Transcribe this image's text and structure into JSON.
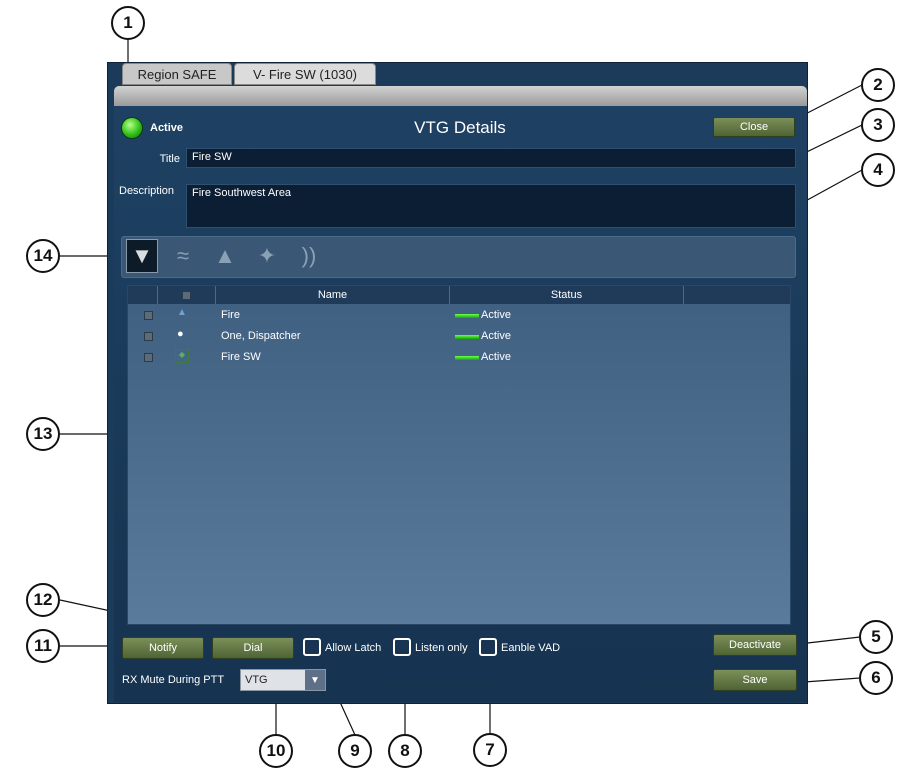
{
  "tabs": [
    {
      "label": "Region SAFE"
    },
    {
      "label": "V- Fire SW (1030)"
    }
  ],
  "header": {
    "status_label": "Active",
    "title": "VTG Details",
    "close_label": "Close"
  },
  "form": {
    "title_label": "Title",
    "title_value": "Fire SW",
    "description_label": "Description",
    "description_value": "Fire Southwest Area"
  },
  "toolbar": {
    "icons": [
      "filter-icon",
      "wifi-icon",
      "stamp-icon",
      "network-icon",
      "broadcast-icon"
    ]
  },
  "table": {
    "columns": [
      "Name",
      "Status"
    ],
    "rows": [
      {
        "name": "Fire",
        "status": "Active",
        "icon": "shield-icon"
      },
      {
        "name": "One, Dispatcher",
        "status": "Active",
        "icon": "person-icon"
      },
      {
        "name": "Fire SW",
        "status": "Active",
        "icon": "group-icon"
      }
    ]
  },
  "footer": {
    "notify_label": "Notify",
    "dial_label": "Dial",
    "allow_latch_label": "Allow Latch",
    "listen_only_label": "Listen only",
    "enable_vad_label": "Eanble VAD",
    "rx_mute_label": "RX Mute During PTT",
    "rx_mute_value": "VTG",
    "deactivate_label": "Deactivate",
    "save_label": "Save"
  },
  "callouts": [
    "1",
    "2",
    "3",
    "4",
    "5",
    "6",
    "7",
    "8",
    "9",
    "10",
    "11",
    "12",
    "13",
    "14"
  ],
  "colors": {
    "panel": "#1c3a5a",
    "button": "#5f7542",
    "status_green": "#3fd12a"
  }
}
